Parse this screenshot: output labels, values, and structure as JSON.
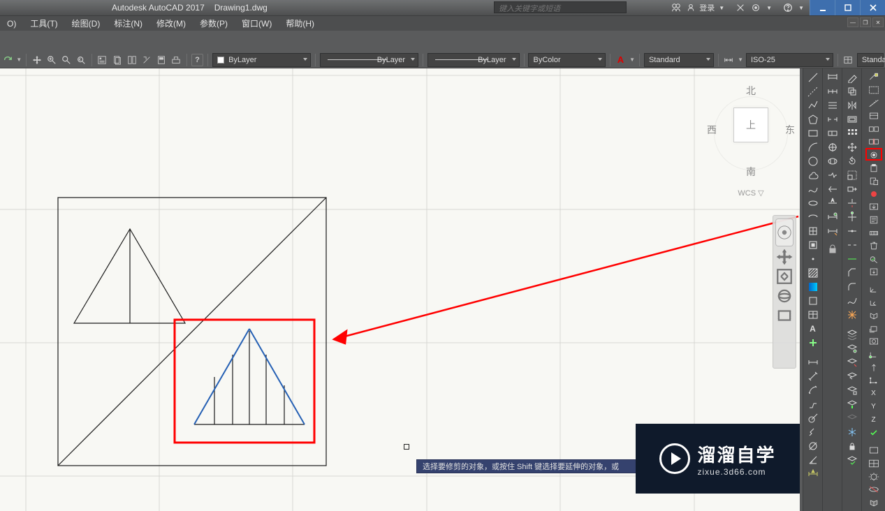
{
  "titlebar": {
    "app": "Autodesk AutoCAD 2017",
    "doc": "Drawing1.dwg",
    "search_placeholder": "键入关键字或短语",
    "login": "登录"
  },
  "menubar": {
    "items": [
      "O)",
      "工具(T)",
      "绘图(D)",
      "标注(N)",
      "修改(M)",
      "参数(P)",
      "窗口(W)",
      "帮助(H)"
    ]
  },
  "propbar": {
    "layer": "ByLayer",
    "linetype": "ByLayer",
    "lineweight": "ByLayer",
    "color": "ByColor",
    "text_style": "Standard",
    "dim_style": "ISO-25",
    "last": "Standa"
  },
  "viewcube": {
    "north": "北",
    "south": "南",
    "east": "东",
    "west": "西",
    "face": "上",
    "wcs": "WCS ▽"
  },
  "tooltip": "选择要修剪的对象，或按住 Shift 键选择要延伸的对象，或",
  "watermark": {
    "cn": "溜溜自学",
    "en": "zixue.3d66.com"
  }
}
